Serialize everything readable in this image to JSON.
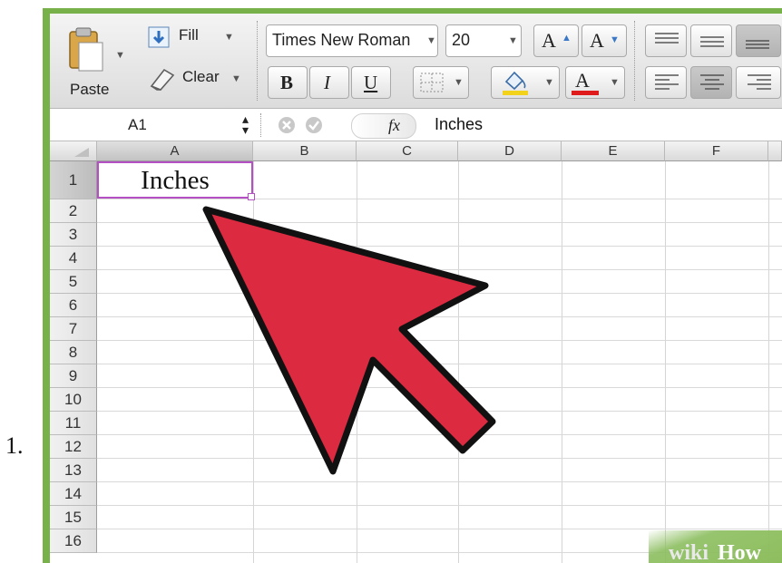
{
  "list_marker": "1.",
  "ribbon": {
    "paste_label": "Paste",
    "fill_label": "Fill",
    "clear_label": "Clear",
    "font_name": "Times New Roman",
    "font_size": "20",
    "grow_font_label": "A",
    "shrink_font_label": "A",
    "bold_label": "B",
    "italic_label": "I",
    "underline_label": "U",
    "font_color_label": "A",
    "highlight_color": "#f2d21a",
    "font_color": "#e01b1b"
  },
  "formula_bar": {
    "name_box": "A1",
    "fx_label": "fx",
    "content": "Inches"
  },
  "sheet": {
    "columns": [
      "A",
      "B",
      "C",
      "D",
      "E",
      "F"
    ],
    "rows": [
      "1",
      "2",
      "3",
      "4",
      "5",
      "6",
      "7",
      "8",
      "9",
      "10",
      "11",
      "12",
      "13",
      "14",
      "15",
      "16"
    ],
    "selected_cell": "A1",
    "cell_a1": "Inches",
    "selection_color": "#b44fc4"
  },
  "annotation": {
    "arrow_color": "#dc2a40"
  },
  "watermark": {
    "wiki": "wiki",
    "how": "How"
  }
}
